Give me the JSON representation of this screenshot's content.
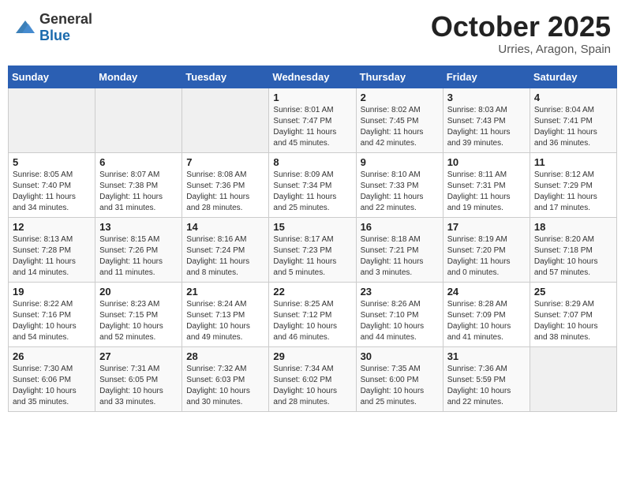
{
  "header": {
    "logo_general": "General",
    "logo_blue": "Blue",
    "month_title": "October 2025",
    "location": "Urries, Aragon, Spain"
  },
  "days_of_week": [
    "Sunday",
    "Monday",
    "Tuesday",
    "Wednesday",
    "Thursday",
    "Friday",
    "Saturday"
  ],
  "weeks": [
    {
      "days": [
        {
          "number": "",
          "info": "",
          "empty": true
        },
        {
          "number": "",
          "info": "",
          "empty": true
        },
        {
          "number": "",
          "info": "",
          "empty": true
        },
        {
          "number": "1",
          "info": "Sunrise: 8:01 AM\nSunset: 7:47 PM\nDaylight: 11 hours\nand 45 minutes."
        },
        {
          "number": "2",
          "info": "Sunrise: 8:02 AM\nSunset: 7:45 PM\nDaylight: 11 hours\nand 42 minutes."
        },
        {
          "number": "3",
          "info": "Sunrise: 8:03 AM\nSunset: 7:43 PM\nDaylight: 11 hours\nand 39 minutes."
        },
        {
          "number": "4",
          "info": "Sunrise: 8:04 AM\nSunset: 7:41 PM\nDaylight: 11 hours\nand 36 minutes."
        }
      ]
    },
    {
      "days": [
        {
          "number": "5",
          "info": "Sunrise: 8:05 AM\nSunset: 7:40 PM\nDaylight: 11 hours\nand 34 minutes."
        },
        {
          "number": "6",
          "info": "Sunrise: 8:07 AM\nSunset: 7:38 PM\nDaylight: 11 hours\nand 31 minutes."
        },
        {
          "number": "7",
          "info": "Sunrise: 8:08 AM\nSunset: 7:36 PM\nDaylight: 11 hours\nand 28 minutes."
        },
        {
          "number": "8",
          "info": "Sunrise: 8:09 AM\nSunset: 7:34 PM\nDaylight: 11 hours\nand 25 minutes."
        },
        {
          "number": "9",
          "info": "Sunrise: 8:10 AM\nSunset: 7:33 PM\nDaylight: 11 hours\nand 22 minutes."
        },
        {
          "number": "10",
          "info": "Sunrise: 8:11 AM\nSunset: 7:31 PM\nDaylight: 11 hours\nand 19 minutes."
        },
        {
          "number": "11",
          "info": "Sunrise: 8:12 AM\nSunset: 7:29 PM\nDaylight: 11 hours\nand 17 minutes."
        }
      ]
    },
    {
      "days": [
        {
          "number": "12",
          "info": "Sunrise: 8:13 AM\nSunset: 7:28 PM\nDaylight: 11 hours\nand 14 minutes."
        },
        {
          "number": "13",
          "info": "Sunrise: 8:15 AM\nSunset: 7:26 PM\nDaylight: 11 hours\nand 11 minutes."
        },
        {
          "number": "14",
          "info": "Sunrise: 8:16 AM\nSunset: 7:24 PM\nDaylight: 11 hours\nand 8 minutes."
        },
        {
          "number": "15",
          "info": "Sunrise: 8:17 AM\nSunset: 7:23 PM\nDaylight: 11 hours\nand 5 minutes."
        },
        {
          "number": "16",
          "info": "Sunrise: 8:18 AM\nSunset: 7:21 PM\nDaylight: 11 hours\nand 3 minutes."
        },
        {
          "number": "17",
          "info": "Sunrise: 8:19 AM\nSunset: 7:20 PM\nDaylight: 11 hours\nand 0 minutes."
        },
        {
          "number": "18",
          "info": "Sunrise: 8:20 AM\nSunset: 7:18 PM\nDaylight: 10 hours\nand 57 minutes."
        }
      ]
    },
    {
      "days": [
        {
          "number": "19",
          "info": "Sunrise: 8:22 AM\nSunset: 7:16 PM\nDaylight: 10 hours\nand 54 minutes."
        },
        {
          "number": "20",
          "info": "Sunrise: 8:23 AM\nSunset: 7:15 PM\nDaylight: 10 hours\nand 52 minutes."
        },
        {
          "number": "21",
          "info": "Sunrise: 8:24 AM\nSunset: 7:13 PM\nDaylight: 10 hours\nand 49 minutes."
        },
        {
          "number": "22",
          "info": "Sunrise: 8:25 AM\nSunset: 7:12 PM\nDaylight: 10 hours\nand 46 minutes."
        },
        {
          "number": "23",
          "info": "Sunrise: 8:26 AM\nSunset: 7:10 PM\nDaylight: 10 hours\nand 44 minutes."
        },
        {
          "number": "24",
          "info": "Sunrise: 8:28 AM\nSunset: 7:09 PM\nDaylight: 10 hours\nand 41 minutes."
        },
        {
          "number": "25",
          "info": "Sunrise: 8:29 AM\nSunset: 7:07 PM\nDaylight: 10 hours\nand 38 minutes."
        }
      ]
    },
    {
      "days": [
        {
          "number": "26",
          "info": "Sunrise: 7:30 AM\nSunset: 6:06 PM\nDaylight: 10 hours\nand 35 minutes."
        },
        {
          "number": "27",
          "info": "Sunrise: 7:31 AM\nSunset: 6:05 PM\nDaylight: 10 hours\nand 33 minutes."
        },
        {
          "number": "28",
          "info": "Sunrise: 7:32 AM\nSunset: 6:03 PM\nDaylight: 10 hours\nand 30 minutes."
        },
        {
          "number": "29",
          "info": "Sunrise: 7:34 AM\nSunset: 6:02 PM\nDaylight: 10 hours\nand 28 minutes."
        },
        {
          "number": "30",
          "info": "Sunrise: 7:35 AM\nSunset: 6:00 PM\nDaylight: 10 hours\nand 25 minutes."
        },
        {
          "number": "31",
          "info": "Sunrise: 7:36 AM\nSunset: 5:59 PM\nDaylight: 10 hours\nand 22 minutes."
        },
        {
          "number": "",
          "info": "",
          "empty": true
        }
      ]
    }
  ]
}
